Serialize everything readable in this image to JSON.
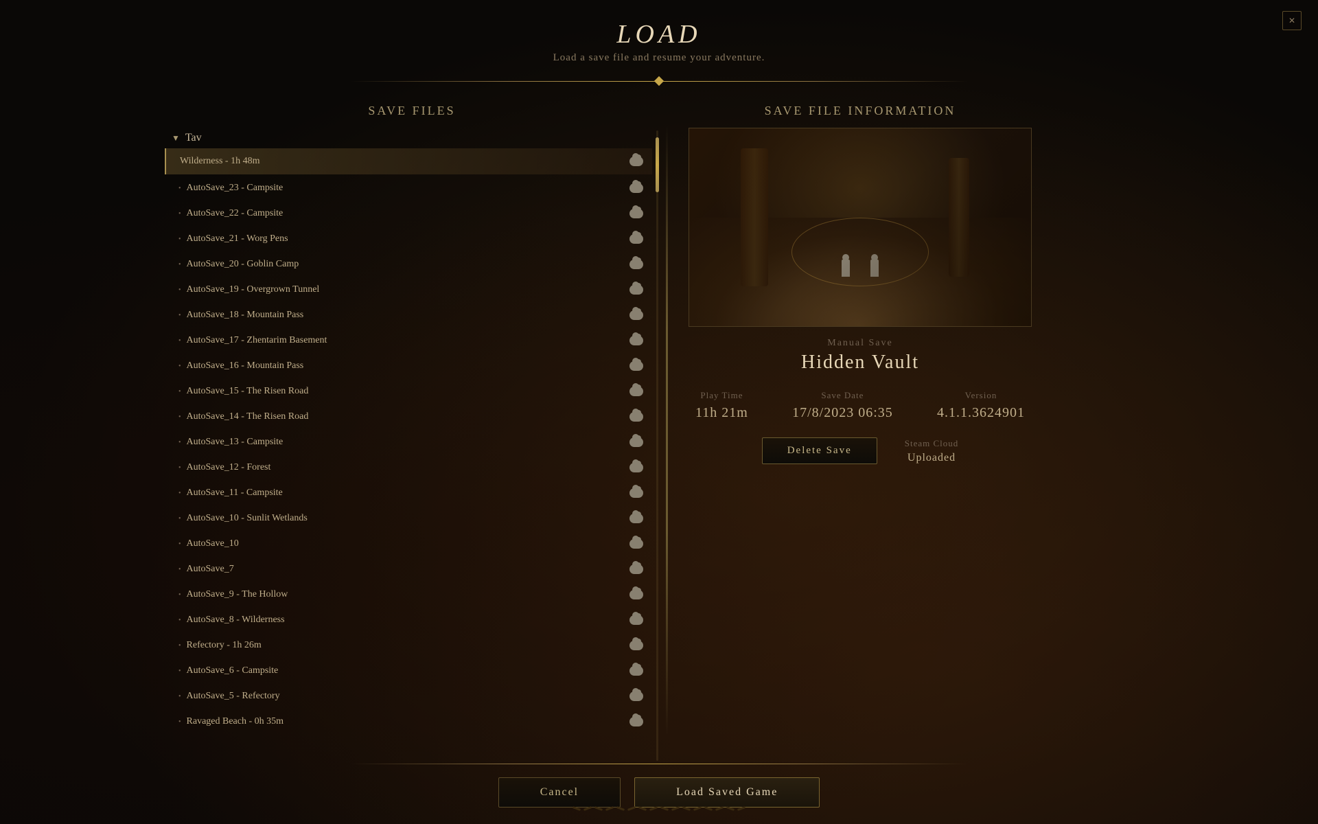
{
  "window": {
    "title": "Load",
    "subtitle": "Load a save file and resume your adventure."
  },
  "left_panel": {
    "title": "Save Files",
    "group": {
      "name": "Tav",
      "expanded": true
    },
    "items": [
      {
        "name": "Wilderness - 1h 48m",
        "is_selected": true,
        "bullet": false
      },
      {
        "name": "AutoSave_23 - Campsite",
        "is_selected": false,
        "bullet": true
      },
      {
        "name": "AutoSave_22 - Campsite",
        "is_selected": false,
        "bullet": true
      },
      {
        "name": "AutoSave_21 - Worg Pens",
        "is_selected": false,
        "bullet": true
      },
      {
        "name": "AutoSave_20 - Goblin Camp",
        "is_selected": false,
        "bullet": true
      },
      {
        "name": "AutoSave_19 - Overgrown Tunnel",
        "is_selected": false,
        "bullet": true
      },
      {
        "name": "AutoSave_18 - Mountain Pass",
        "is_selected": false,
        "bullet": true
      },
      {
        "name": "AutoSave_17 - Zhentarim Basement",
        "is_selected": false,
        "bullet": true
      },
      {
        "name": "AutoSave_16 - Mountain Pass",
        "is_selected": false,
        "bullet": true
      },
      {
        "name": "AutoSave_15 - The Risen Road",
        "is_selected": false,
        "bullet": true
      },
      {
        "name": "AutoSave_14 - The Risen Road",
        "is_selected": false,
        "bullet": true
      },
      {
        "name": "AutoSave_13 - Campsite",
        "is_selected": false,
        "bullet": true
      },
      {
        "name": "AutoSave_12 - Forest",
        "is_selected": false,
        "bullet": true
      },
      {
        "name": "AutoSave_11 - Campsite",
        "is_selected": false,
        "bullet": true
      },
      {
        "name": "AutoSave_10 - Sunlit Wetlands",
        "is_selected": false,
        "bullet": true
      },
      {
        "name": "AutoSave_10",
        "is_selected": false,
        "bullet": true
      },
      {
        "name": "AutoSave_7",
        "is_selected": false,
        "bullet": true
      },
      {
        "name": "AutoSave_9 - The Hollow",
        "is_selected": false,
        "bullet": true
      },
      {
        "name": "AutoSave_8 - Wilderness",
        "is_selected": false,
        "bullet": true
      },
      {
        "name": "Refectory - 1h 26m",
        "is_selected": false,
        "bullet": true
      },
      {
        "name": "AutoSave_6 - Campsite",
        "is_selected": false,
        "bullet": true
      },
      {
        "name": "AutoSave_5 - Refectory",
        "is_selected": false,
        "bullet": true
      },
      {
        "name": "Ravaged Beach - 0h 35m",
        "is_selected": false,
        "bullet": true
      }
    ]
  },
  "right_panel": {
    "title": "Save File Information",
    "save_type": "Manual Save",
    "save_name": "Hidden Vault",
    "stats": {
      "play_time_label": "Play Time",
      "play_time_value": "11h 21m",
      "save_date_label": "Save Date",
      "save_date_value": "17/8/2023 06:35",
      "version_label": "Version",
      "version_value": "4.1.1.3624901"
    },
    "delete_button": "Delete Save",
    "cloud_status_label": "Steam Cloud",
    "cloud_status_value": "Uploaded"
  },
  "bottom_bar": {
    "cancel_label": "Cancel",
    "load_label": "Load Saved Game"
  }
}
